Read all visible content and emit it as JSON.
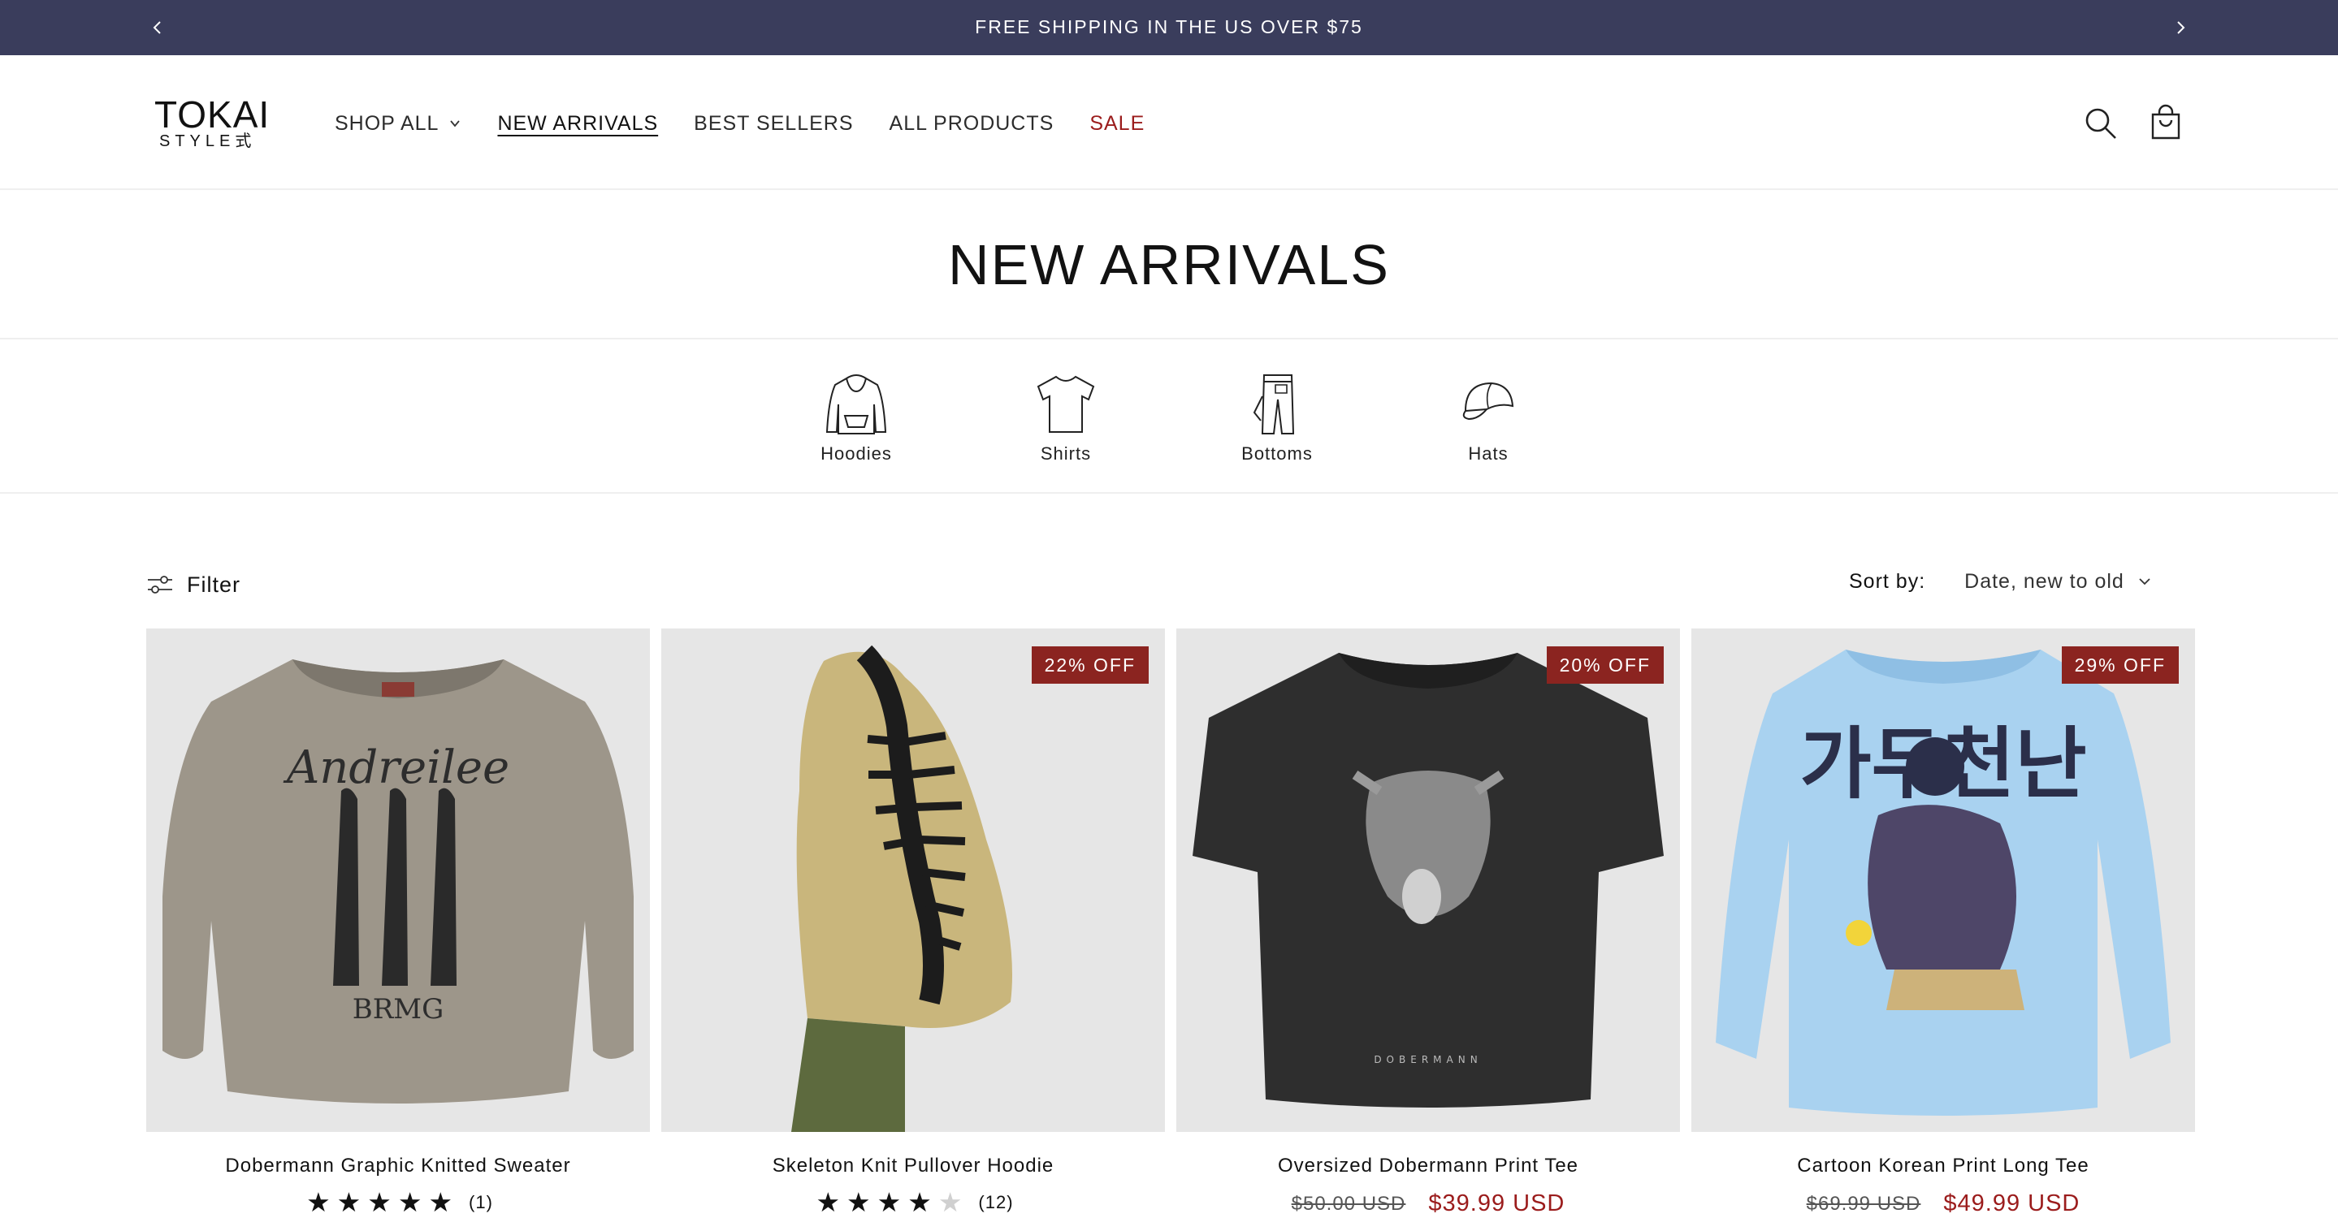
{
  "announcement": {
    "text": "FREE SHIPPING IN THE US OVER $75"
  },
  "logo": {
    "line1": "TOKAI",
    "line2": "STYLE式"
  },
  "nav": {
    "items": [
      {
        "label": "SHOP ALL"
      },
      {
        "label": "NEW ARRIVALS"
      },
      {
        "label": "BEST SELLERS"
      },
      {
        "label": "ALL PRODUCTS"
      },
      {
        "label": "SALE"
      }
    ]
  },
  "page": {
    "title": "NEW ARRIVALS"
  },
  "categories": [
    {
      "label": "Hoodies",
      "icon": "hoodie-icon"
    },
    {
      "label": "Shirts",
      "icon": "shirt-icon"
    },
    {
      "label": "Bottoms",
      "icon": "pants-icon"
    },
    {
      "label": "Hats",
      "icon": "cap-icon"
    }
  ],
  "toolbar": {
    "filter_label": "Filter",
    "sort_label": "Sort by:",
    "sort_value": "Date, new to old"
  },
  "products": [
    {
      "name": "Dobermann Graphic Knitted Sweater",
      "badge": "",
      "rating": 5,
      "review_count": "(1)",
      "old_price": "",
      "price": "",
      "print_text": "Andreilee",
      "print_text2": "BRMG"
    },
    {
      "name": "Skeleton Knit Pullover Hoodie",
      "badge": "22% OFF",
      "rating": 4,
      "review_count": "(12)",
      "old_price": "",
      "price": ""
    },
    {
      "name": "Oversized Dobermann Print Tee",
      "badge": "20% OFF",
      "rating": 0,
      "review_count": "",
      "old_price": "$50.00 USD",
      "price": "$39.99 USD",
      "print_text": "DOBERMANN"
    },
    {
      "name": "Cartoon Korean Print Long Tee",
      "badge": "29% OFF",
      "rating": 0,
      "review_count": "",
      "old_price": "$69.99 USD",
      "price": "$49.99 USD",
      "print_text": "가두천난"
    }
  ],
  "colors": {
    "announce_bg": "#3a3d5c",
    "sale_red": "#9b1c1c",
    "badge_bg": "#8b2420",
    "card_bg": "#e6e6e6"
  }
}
